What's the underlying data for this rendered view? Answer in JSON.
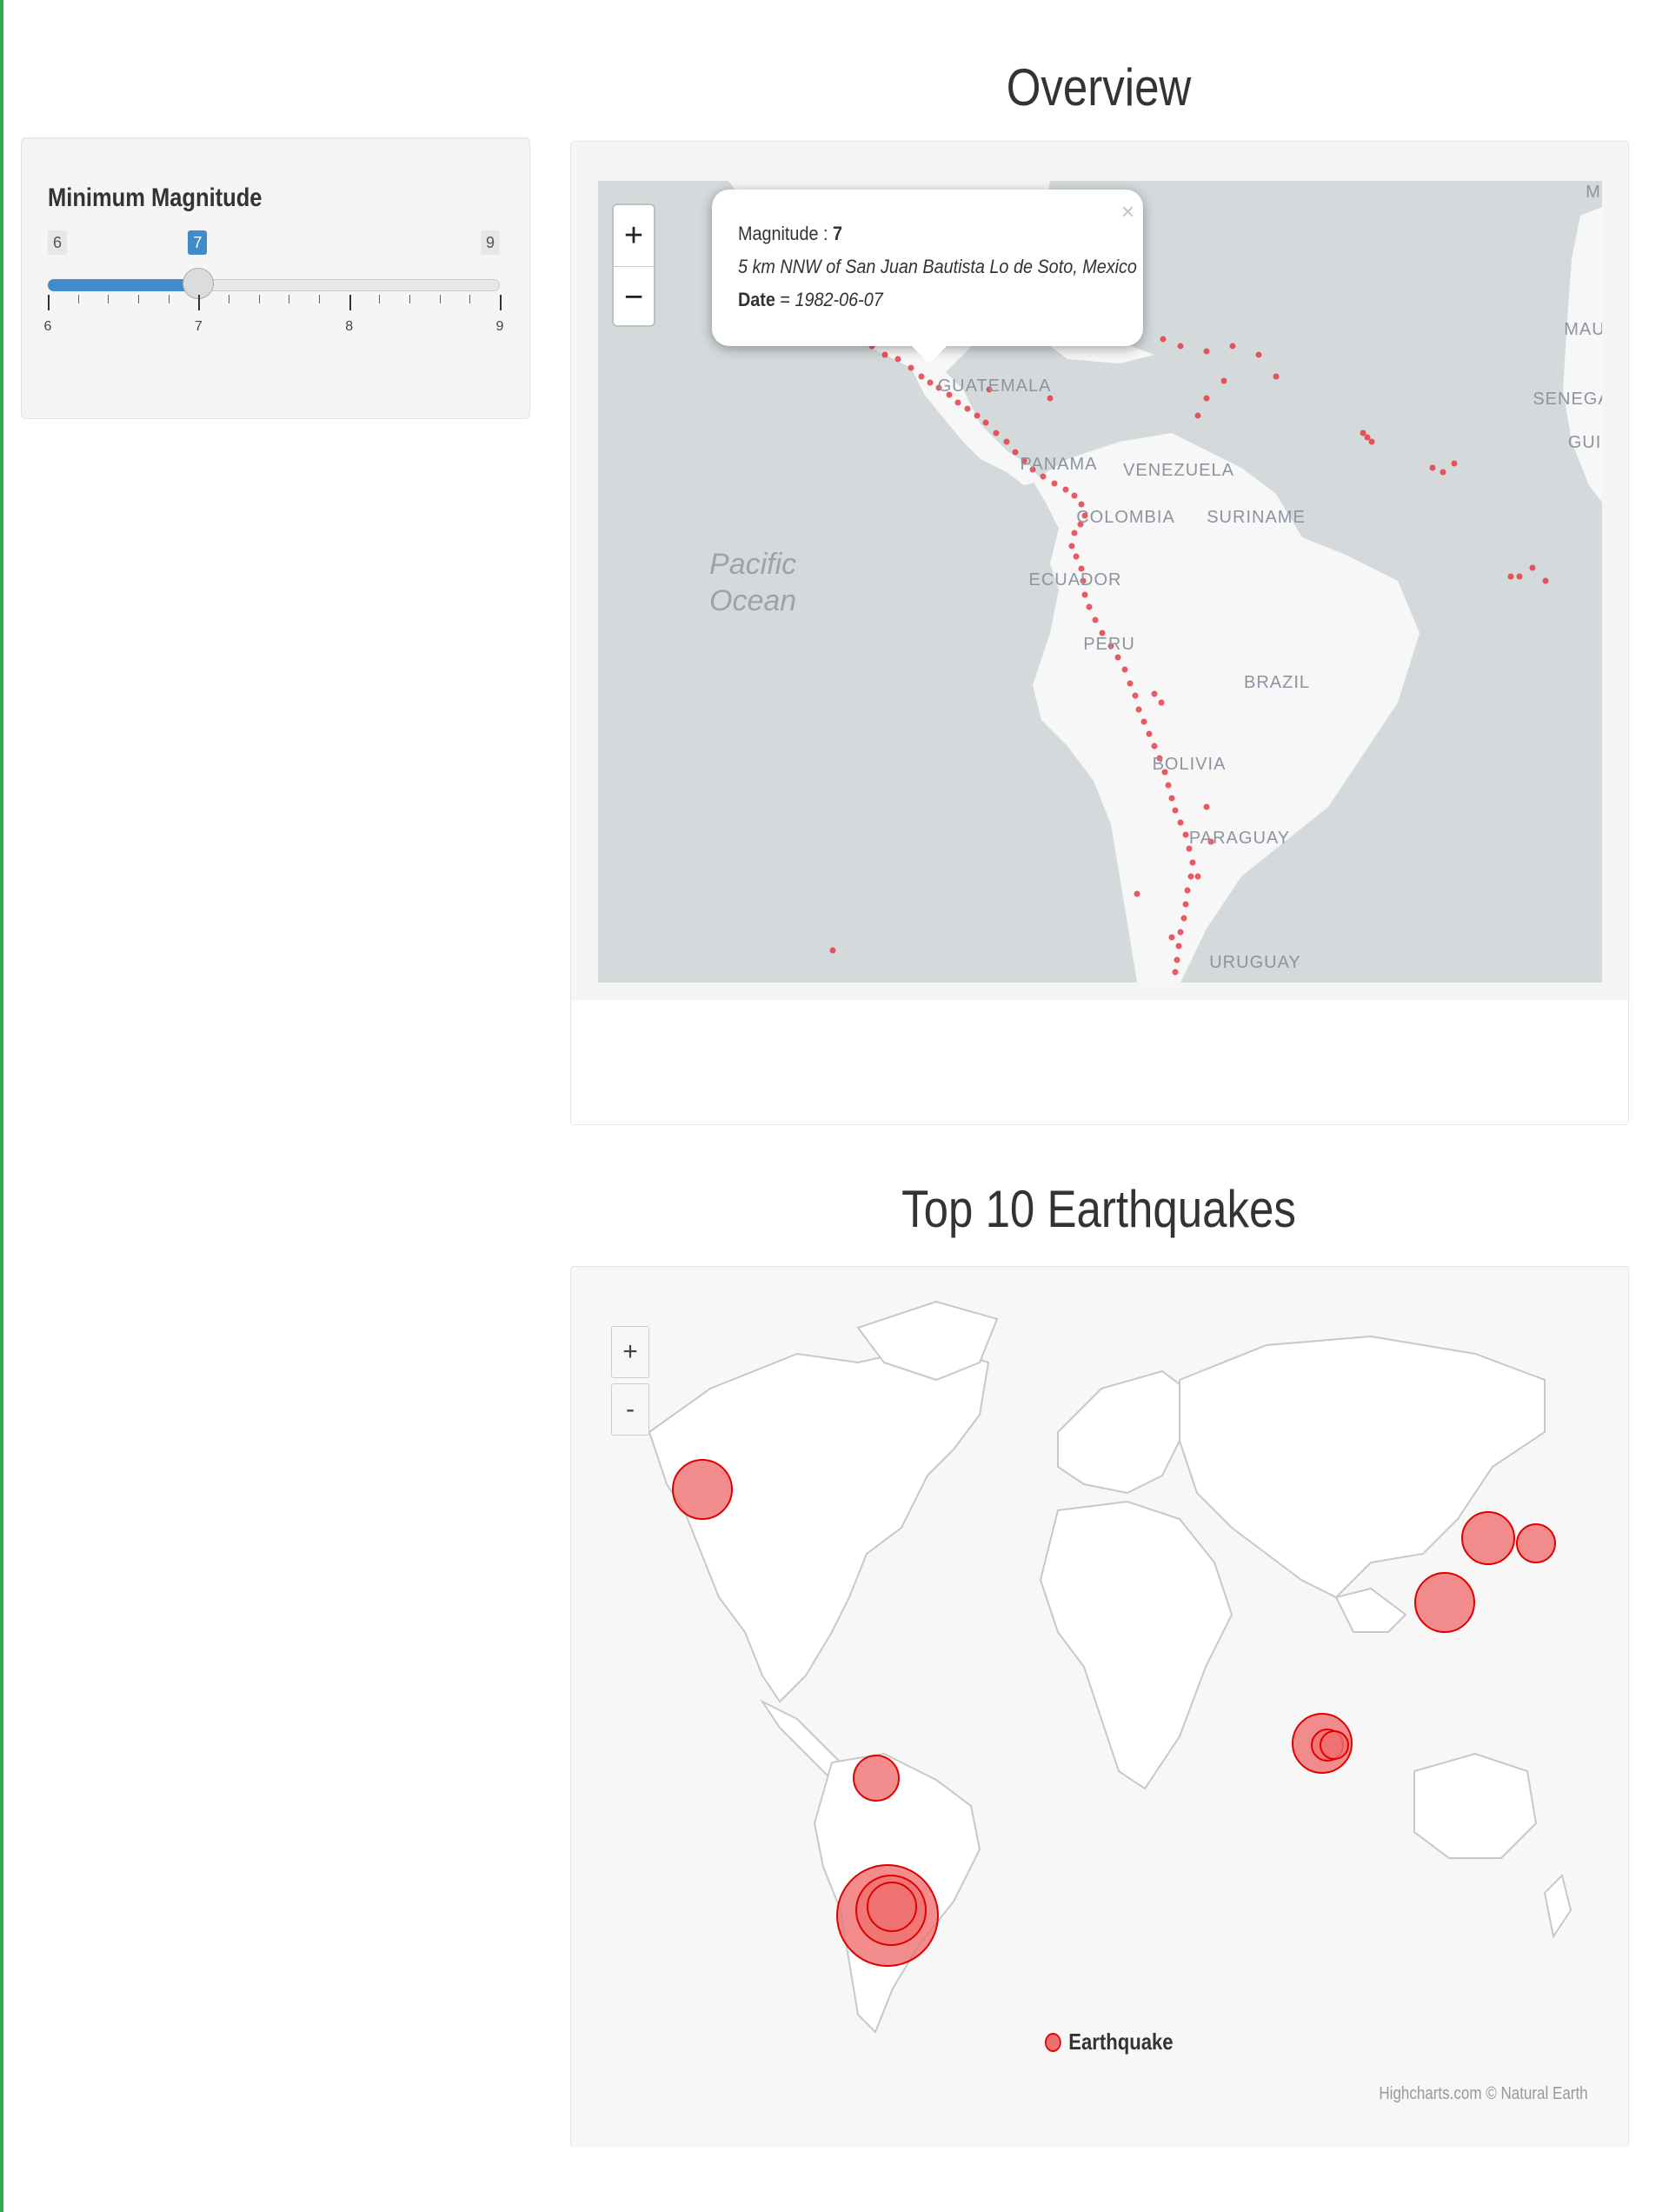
{
  "sidebar": {
    "label": "Minimum Magnitude",
    "slider": {
      "min": 6,
      "max": 9,
      "value": 7,
      "min_label": "6",
      "max_label": "9",
      "value_label": "7",
      "ticks": [
        "6",
        "7",
        "8",
        "9"
      ]
    }
  },
  "overview": {
    "title": "Overview",
    "zoom_in": "+",
    "zoom_out": "−",
    "popup": {
      "close": "×",
      "magnitude_label": "Magnitude : ",
      "magnitude_value": "7",
      "place": "5 km NNW of San Juan Bautista Lo de Soto, Mexico",
      "date_label": "Date",
      "date_sep": " = ",
      "date_value": "1982-06-07"
    },
    "labels": {
      "guatemala": "GUATEMALA",
      "panama": "PANAMA",
      "venezuela": "VENEZUELA",
      "colombia": "COLOMBIA",
      "suriname": "SURINAME",
      "ecuador": "ECUADOR",
      "peru": "PERU",
      "brazil": "BRAZIL",
      "bolivia": "BOLIVIA",
      "paraguay": "PARAGUAY",
      "uruguay": "URUGUAY",
      "mau": "MAU",
      "senega": "SENEGA",
      "gui": "GUI",
      "m": "M",
      "ocean_line1": "Pacific",
      "ocean_line2": "Ocean"
    },
    "colors": {
      "land": "#f7f7f7",
      "water": "#d4dadc",
      "quake": "#e8303a"
    }
  },
  "top10": {
    "title": "Top 10 Earthquakes",
    "zoom_in": "+",
    "zoom_out": "-",
    "legend": "Earthquake",
    "credits": "Highcharts.com © Natural Earth",
    "colors": {
      "bubble_fill": "#f07070",
      "bubble_stroke": "#e00000"
    }
  }
}
